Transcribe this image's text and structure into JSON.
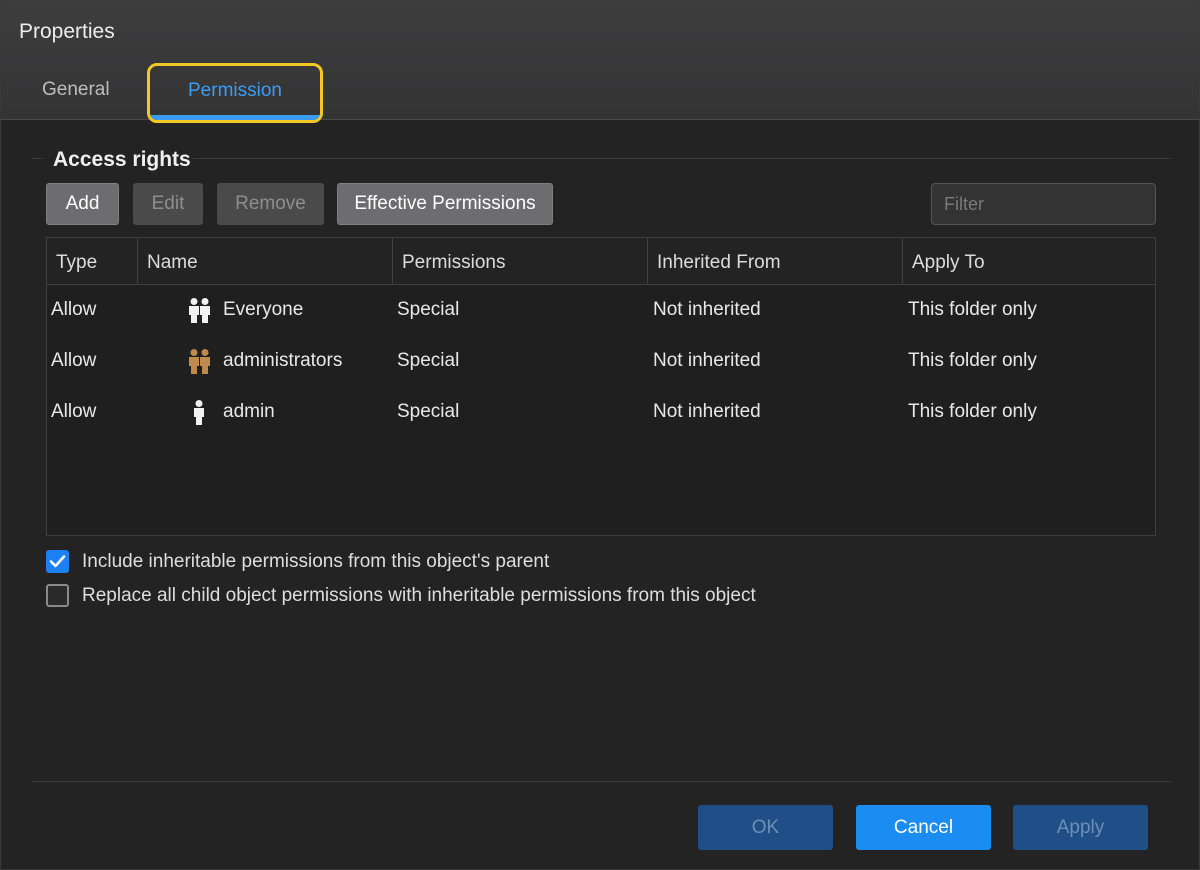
{
  "dialog": {
    "title": "Properties"
  },
  "tabs": [
    {
      "label": "General",
      "active": false
    },
    {
      "label": "Permission",
      "active": true
    }
  ],
  "section": {
    "title": "Access rights"
  },
  "toolbar": {
    "add_label": "Add",
    "edit_label": "Edit",
    "remove_label": "Remove",
    "effective_label": "Effective Permissions",
    "filter_placeholder": "Filter"
  },
  "table": {
    "columns": [
      "Type",
      "Name",
      "Permissions",
      "Inherited From",
      "Apply To"
    ],
    "rows": [
      {
        "type": "Allow",
        "name": "Everyone",
        "icon": "group-icon",
        "permissions": "Special",
        "inherited": "Not inherited",
        "apply": "This folder only"
      },
      {
        "type": "Allow",
        "name": "administrators",
        "icon": "admin-group-icon",
        "permissions": "Special",
        "inherited": "Not inherited",
        "apply": "This folder only"
      },
      {
        "type": "Allow",
        "name": "admin",
        "icon": "user-icon",
        "permissions": "Special",
        "inherited": "Not inherited",
        "apply": "This folder only"
      }
    ]
  },
  "options": {
    "include_label": "Include inheritable permissions from this object's parent",
    "include_checked": true,
    "replace_label": "Replace all child object permissions with inheritable permissions from this object",
    "replace_checked": false
  },
  "footer": {
    "ok_label": "OK",
    "cancel_label": "Cancel",
    "apply_label": "Apply"
  },
  "colors": {
    "accent": "#1a8cf2",
    "highlight_border": "#f3c826",
    "admin_group_icon": "#c08a4a"
  }
}
